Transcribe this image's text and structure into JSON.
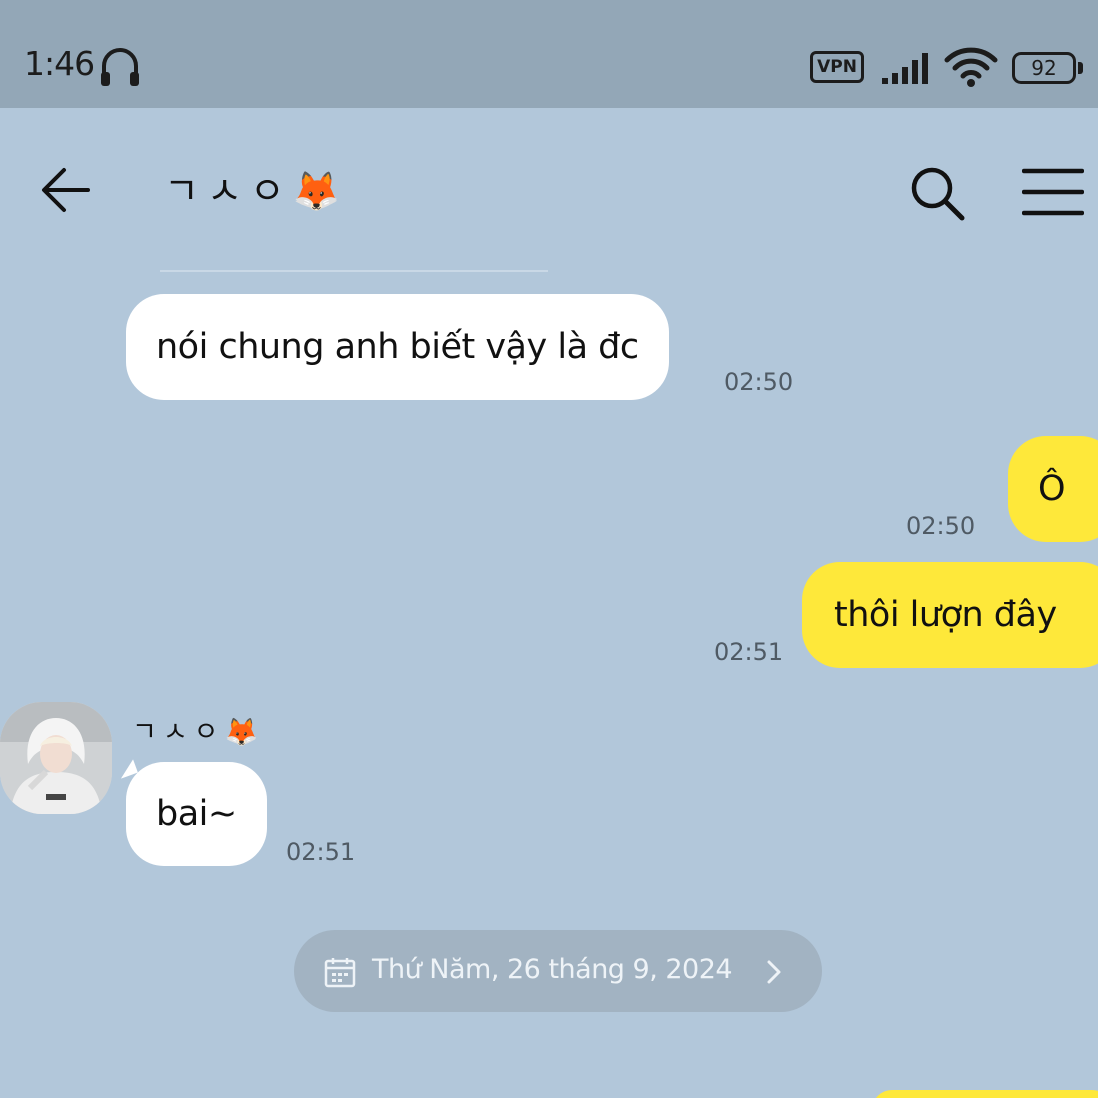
{
  "status_bar": {
    "time": "1:46",
    "vpn": "VPN",
    "battery": "92"
  },
  "header": {
    "title": "ㄱㅅㅇ🦊"
  },
  "messages": [
    {
      "side": "in",
      "text": "nói chung anh biết vậy là đc",
      "time": "02:50"
    },
    {
      "side": "out",
      "text": "Ô",
      "time": "02:50"
    },
    {
      "side": "out",
      "text": "thôi lượn đây",
      "time": "02:51"
    },
    {
      "side": "in",
      "sender": "ㄱㅅㅇ🦊",
      "text": "bai~",
      "time": "02:51"
    }
  ],
  "date_separator": {
    "label": "Thứ Năm, 26 tháng 9, 2024"
  },
  "colors": {
    "chat_background": "#b2c7da",
    "status_bar": "#93a7b7",
    "incoming_bubble": "#ffffff",
    "outgoing_bubble": "#fee83a"
  },
  "icons": {
    "status": [
      "headset-icon",
      "signal-icon",
      "wifi-icon",
      "battery-icon"
    ],
    "header": [
      "back-arrow-icon",
      "search-icon",
      "menu-icon"
    ],
    "date_chip": [
      "calendar-icon",
      "chevron-right-icon"
    ]
  }
}
